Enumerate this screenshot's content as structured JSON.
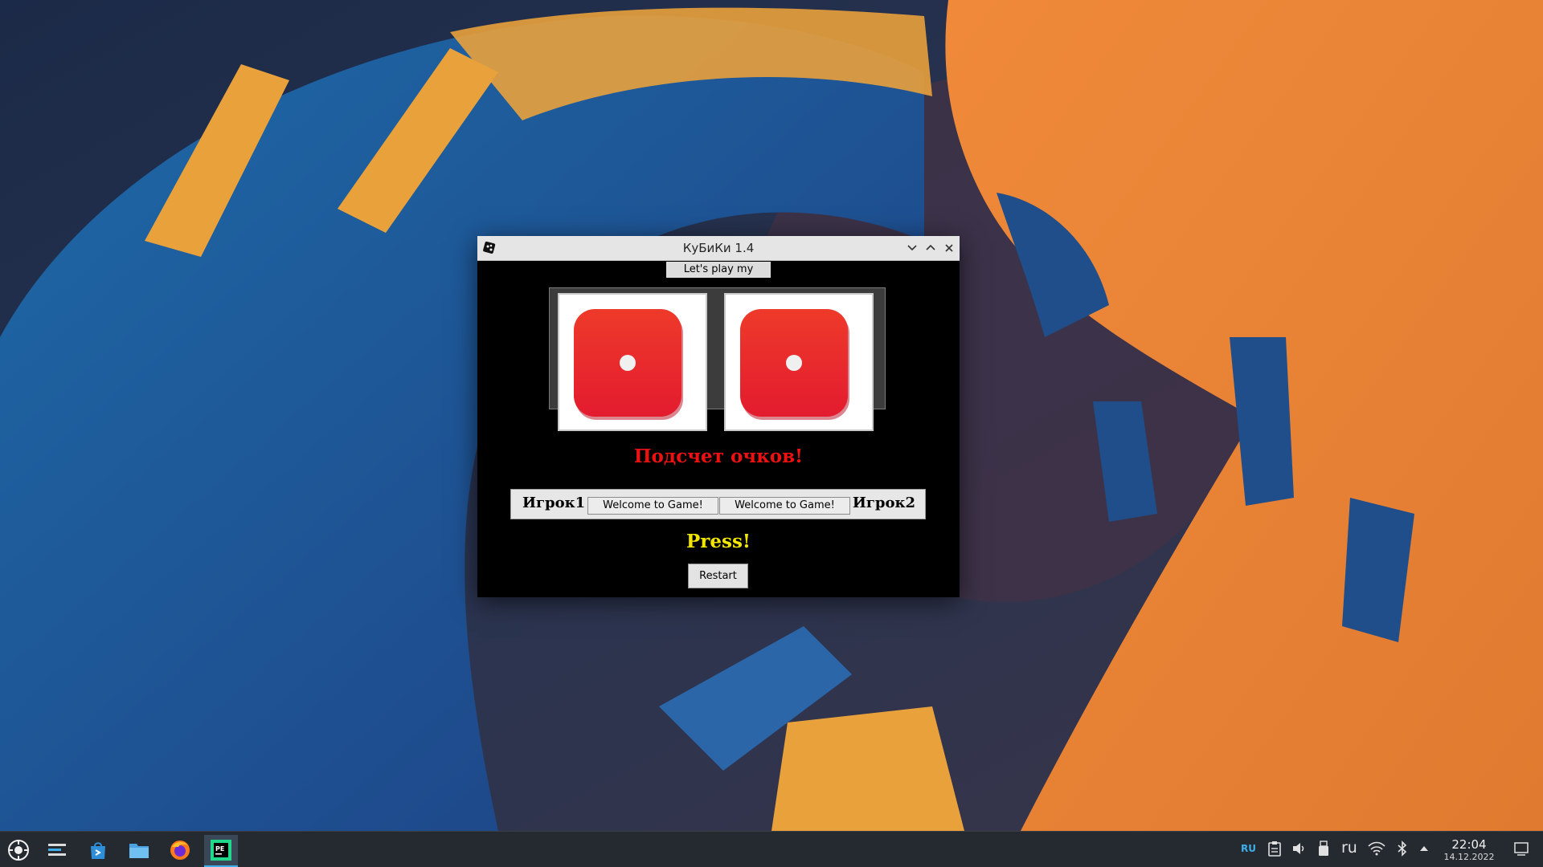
{
  "window": {
    "title": "КуБиКи 1.4",
    "welcome_label": "Let's play my game!",
    "dice": [
      1,
      1
    ],
    "score_title": "Подсчет очков!",
    "player1_label": "Игрок1",
    "player1_score": "Welcome to Game!",
    "player2_score": "Welcome to Game!",
    "player2_label": "Игрок2",
    "press_label": "Press!",
    "restart_label": "Restart"
  },
  "taskbar": {
    "apps": [
      "application-launcher-icon",
      "overview-icon",
      "store-icon",
      "file-manager-icon",
      "firefox-icon",
      "pycharm-icon"
    ],
    "active_app": "pycharm-icon",
    "tray": {
      "language_indicator": "RU",
      "keyboard_layout": "ru",
      "icons": [
        "clipboard-icon",
        "volume-icon",
        "usb-icon",
        "wifi-icon",
        "bluetooth-icon",
        "expand-tray-icon"
      ]
    },
    "clock": {
      "time": "22:04",
      "date": "14.12.2022"
    }
  },
  "colors": {
    "score_title": "#ee1111",
    "press_label": "#f2e600",
    "die_red": "#e8302b",
    "taskbar_bg": "#252a30",
    "accent": "#3daee9"
  }
}
